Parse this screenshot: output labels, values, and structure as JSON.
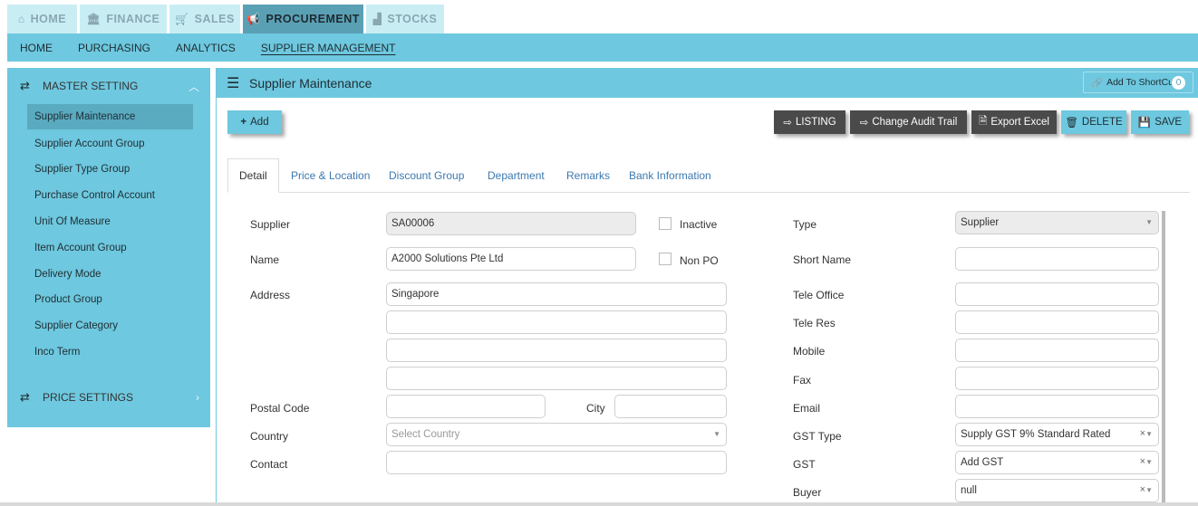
{
  "top_tabs": [
    {
      "label": "HOME",
      "icon": "home-icon",
      "active": false
    },
    {
      "label": "FINANCE",
      "icon": "bank-icon",
      "active": false
    },
    {
      "label": "SALES",
      "icon": "cart-icon",
      "active": false
    },
    {
      "label": "PROCUREMENT",
      "icon": "megaphone-icon",
      "active": true
    },
    {
      "label": "STOCKS",
      "icon": "bar-chart-icon",
      "active": false
    }
  ],
  "sub_nav": [
    {
      "label": "HOME",
      "active": false
    },
    {
      "label": "PURCHASING",
      "active": false
    },
    {
      "label": "ANALYTICS",
      "active": false
    },
    {
      "label": "SUPPLIER MANAGEMENT",
      "active": true
    }
  ],
  "sidebar": {
    "master_setting": "MASTER SETTING",
    "items": [
      {
        "label": "Supplier Maintenance",
        "active": true
      },
      {
        "label": "Supplier Account Group"
      },
      {
        "label": "Supplier Type Group"
      },
      {
        "label": "Purchase Control Account"
      },
      {
        "label": "Unit Of Measure"
      },
      {
        "label": "Item Account Group"
      },
      {
        "label": "Delivery Mode"
      },
      {
        "label": "Product Group"
      },
      {
        "label": "Supplier Category"
      },
      {
        "label": "Inco Term"
      }
    ],
    "price_settings": "PRICE SETTINGS"
  },
  "panel": {
    "title": "Supplier Maintenance",
    "shortcut_label": "Add To ShortCut",
    "shortcut_count": "0"
  },
  "toolbar": {
    "add": "Add",
    "listing": "LISTING",
    "audit": "Change Audit Trail",
    "export": "Export Excel",
    "delete": "DELETE",
    "save": "SAVE"
  },
  "tabs": [
    "Detail",
    "Price & Location",
    "Discount Group",
    "Department",
    "Remarks",
    "Bank Information"
  ],
  "form": {
    "supplier_label": "Supplier",
    "supplier_value": "SA00006",
    "inactive_label": "Inactive",
    "name_label": "Name",
    "name_value": "A2000 Solutions Pte Ltd",
    "nonpo_label": "Non PO",
    "address_label": "Address",
    "address1": "Singapore",
    "postal_label": "Postal Code",
    "city_label": "City",
    "country_label": "Country",
    "country_placeholder": "Select Country",
    "contact_label": "Contact",
    "type_label": "Type",
    "type_value": "Supplier",
    "short_name_label": "Short Name",
    "tele_office_label": "Tele Office",
    "tele_res_label": "Tele Res",
    "mobile_label": "Mobile",
    "fax_label": "Fax",
    "email_label": "Email",
    "gst_type_label": "GST Type",
    "gst_type_value": "Supply GST 9% Standard Rated",
    "gst_label": "GST",
    "gst_value": "Add GST",
    "buyer_label": "Buyer",
    "buyer_value": "null"
  },
  "colors": {
    "accent": "#6ec8df",
    "active_tab": "#5aa0b5",
    "dark_button": "#4a4a4a"
  }
}
